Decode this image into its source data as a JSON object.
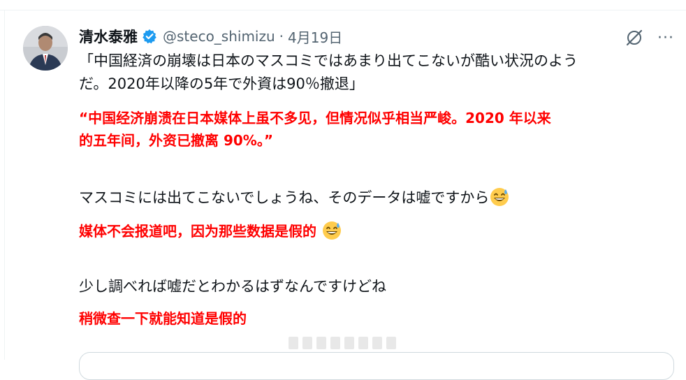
{
  "tweet": {
    "author_name": "清水泰雅",
    "handle": "@steco_shimizu",
    "separator": "·",
    "date": "4月19日",
    "lines": {
      "jp1_line1": "「中国経済の崩壊は日本のマスコミではあまり出てこないが酷い状況のよう",
      "jp1_line2": "だ。2020年以降の5年で外資は90％撤退」",
      "cn1_line1": "“中国经济崩溃在日本媒体上虽不多见，但情况似乎相当严峻。2020 年以来",
      "cn1_line2": "的五年间，外资已撤离 90%。”",
      "jp2": "マスコミには出てこないでしょうね、そのデータは嘘ですから",
      "cn2": "媒体不会报道吧，因为那些数据是假的 ",
      "jp3": "少し調べれば嘘だとわかるはずなんですけどね",
      "cn3": "稍微查一下就能知道是假的"
    },
    "icons": {
      "verified": "verified-badge-icon",
      "grok": "grok-icon",
      "more": "more-icon",
      "emoji": "grinning-sweat-emoji"
    },
    "colors": {
      "accent": "#1d9bf0",
      "translation_text": "#ff0000",
      "secondary_text": "#536471",
      "primary_text": "#0f1419"
    },
    "more_label": "···"
  }
}
